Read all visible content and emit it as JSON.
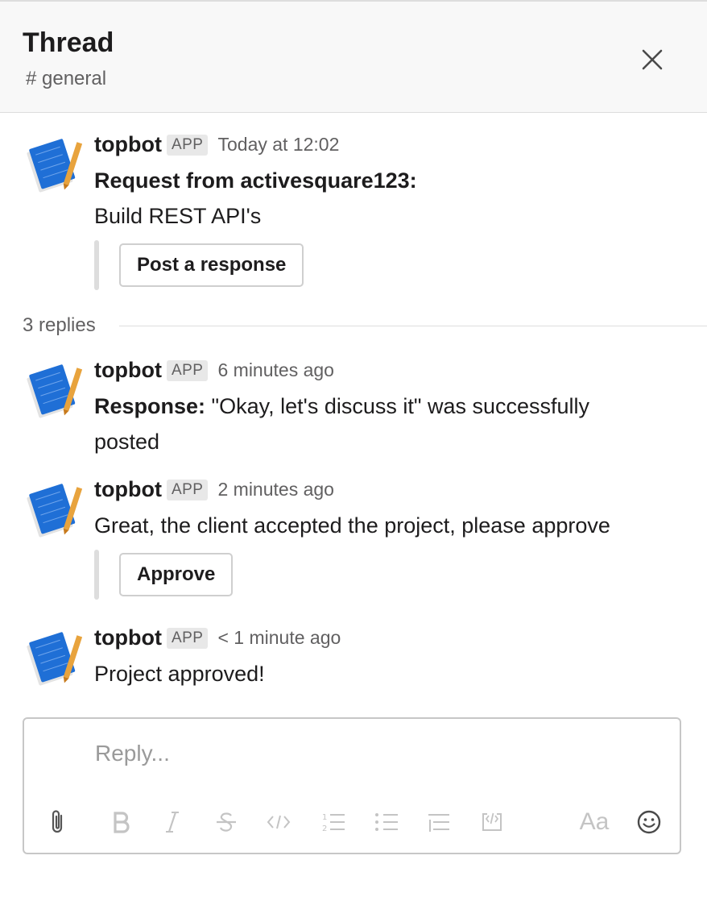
{
  "header": {
    "title": "Thread",
    "channel": "# general"
  },
  "parent": {
    "author": "topbot",
    "badge": "APP",
    "time": "Today at 12:02",
    "line1": "Request from activesquare123:",
    "line2": "Build REST API's",
    "button": "Post a response"
  },
  "replies_label": "3 replies",
  "replies": [
    {
      "author": "topbot",
      "badge": "APP",
      "time": "6 minutes ago",
      "prefix": "Response:",
      "text1": " \"Okay, let's discuss it\" was successfully",
      "text2": "posted"
    },
    {
      "author": "topbot",
      "badge": "APP",
      "time": "2 minutes ago",
      "text": "Great, the client accepted the project, please approve",
      "button": "Approve"
    },
    {
      "author": "topbot",
      "badge": "APP",
      "time": "< 1 minute ago",
      "text": "Project approved!"
    }
  ],
  "composer": {
    "placeholder": "Reply...",
    "font_label": "Aa",
    "icons": [
      "paperclip-icon",
      "bold-icon",
      "italic-icon",
      "strikethrough-icon",
      "code-icon",
      "numbered-list-icon",
      "bulleted-list-icon",
      "indent-icon",
      "code-block-icon",
      "format-toggle-icon",
      "emoji-icon"
    ]
  },
  "colors": {
    "text": "#1d1c1d",
    "muted": "#616061",
    "border": "#dddddd",
    "avatar_blue": "#1f6fd6",
    "avatar_pencil": "#e8a33d"
  }
}
